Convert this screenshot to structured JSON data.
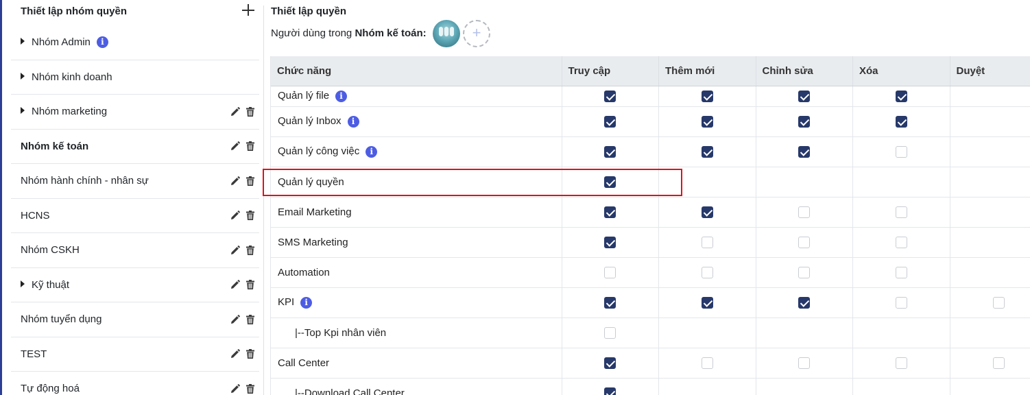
{
  "sidebar": {
    "title": "Thiết lập nhóm quyền",
    "groups": [
      {
        "label": "Nhóm Admin",
        "caret": true,
        "info": true,
        "actions": false,
        "bold": false
      },
      {
        "label": "Nhóm kinh doanh",
        "caret": true,
        "info": false,
        "actions": false,
        "bold": false
      },
      {
        "label": "Nhóm marketing",
        "caret": true,
        "info": false,
        "actions": true,
        "bold": false
      },
      {
        "label": "Nhóm kế toán",
        "caret": false,
        "info": false,
        "actions": true,
        "bold": true
      },
      {
        "label": "Nhóm hành chính - nhân sự",
        "caret": false,
        "info": false,
        "actions": true,
        "bold": false
      },
      {
        "label": "HCNS",
        "caret": false,
        "info": false,
        "actions": true,
        "bold": false
      },
      {
        "label": "Nhóm CSKH",
        "caret": false,
        "info": false,
        "actions": true,
        "bold": false
      },
      {
        "label": "Kỹ thuật",
        "caret": true,
        "info": false,
        "actions": true,
        "bold": false
      },
      {
        "label": "Nhóm tuyển dụng",
        "caret": false,
        "info": false,
        "actions": true,
        "bold": false
      },
      {
        "label": "TEST",
        "caret": false,
        "info": false,
        "actions": true,
        "bold": false
      },
      {
        "label": "Tự động hoá",
        "caret": false,
        "info": false,
        "actions": true,
        "bold": false
      }
    ]
  },
  "main": {
    "title": "Thiết lập quyền",
    "users_prefix": "Người dùng trong",
    "users_group": "Nhóm kế toán:",
    "add_user_symbol": "+"
  },
  "table": {
    "headers": [
      "Chức năng",
      "Truy cập",
      "Thêm mới",
      "Chỉnh sửa",
      "Xóa",
      "Duyệt"
    ],
    "rows": [
      {
        "label": "Quản lý file",
        "info": true,
        "indent": false,
        "cells": [
          "on",
          "on",
          "on",
          "on",
          "none"
        ]
      },
      {
        "label": "Quản lý Inbox",
        "info": true,
        "indent": false,
        "cells": [
          "on",
          "on",
          "on",
          "on",
          "none"
        ]
      },
      {
        "label": "Quản lý công việc",
        "info": true,
        "indent": false,
        "cells": [
          "on",
          "on",
          "on",
          "off",
          "none"
        ]
      },
      {
        "label": "Quản lý quyền",
        "info": false,
        "indent": false,
        "cells": [
          "on",
          "none",
          "none",
          "none",
          "none"
        ]
      },
      {
        "label": "Email Marketing",
        "info": false,
        "indent": false,
        "cells": [
          "on",
          "on",
          "off",
          "off",
          "none"
        ]
      },
      {
        "label": "SMS Marketing",
        "info": false,
        "indent": false,
        "cells": [
          "on",
          "off",
          "off",
          "off",
          "none"
        ]
      },
      {
        "label": "Automation",
        "info": false,
        "indent": false,
        "cells": [
          "off",
          "off",
          "off",
          "off",
          "none"
        ]
      },
      {
        "label": "KPI",
        "info": true,
        "indent": false,
        "cells": [
          "on",
          "on",
          "on",
          "off",
          "off"
        ]
      },
      {
        "label": "|--Top Kpi nhân viên",
        "info": false,
        "indent": true,
        "cells": [
          "off",
          "none",
          "none",
          "none",
          "none"
        ]
      },
      {
        "label": "Call Center",
        "info": false,
        "indent": false,
        "cells": [
          "on",
          "off",
          "off",
          "off",
          "off"
        ]
      },
      {
        "label": "|--Download Call Center",
        "info": false,
        "indent": true,
        "cells": [
          "on",
          "none",
          "none",
          "none",
          "none"
        ]
      }
    ]
  },
  "colors": {
    "checkbox_checked": "#27396a",
    "info_icon": "#4d5de3",
    "highlight_border": "#e0111b",
    "header_bg": "#e9ecef"
  }
}
